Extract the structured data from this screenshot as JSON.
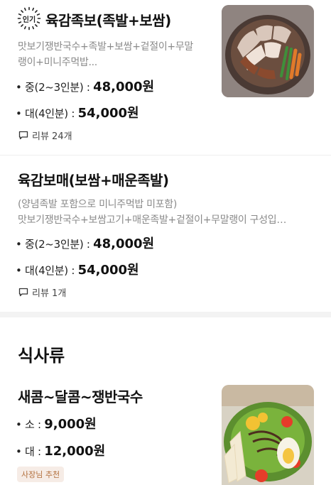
{
  "items": [
    {
      "popular_badge": "인기",
      "name": "육감족보(족발+보쌈)",
      "desc_line1": "맛보기쟁반국수+족발+보쌈+겉절이+무말",
      "desc_line2": "랭이+미니주먹밥...",
      "options": [
        {
          "label": "• 중(2~3인분) : ",
          "price": "48,000원"
        },
        {
          "label": "• 대(4인분) : ",
          "price": "54,000원"
        }
      ],
      "review": "리뷰 24개"
    },
    {
      "name": "육감보매(보쌈+매운족발)",
      "desc_line1": "(양념족발 포함으로 미니주먹밥 미포함)",
      "desc_line2": "맛보기쟁반국수+보쌈고기+매운족발+겉절이+무말랭이 구성입…",
      "options": [
        {
          "label": "• 중(2~3인분) : ",
          "price": "48,000원"
        },
        {
          "label": "• 대(4인분) : ",
          "price": "54,000원"
        }
      ],
      "review": "리뷰 1개"
    }
  ],
  "section": {
    "title": "식사류",
    "item": {
      "name": "새콤~달콤~쟁반국수",
      "options": [
        {
          "label": "• 소 : ",
          "price": "9,000원"
        },
        {
          "label": "• 대 : ",
          "price": "12,000원"
        }
      ],
      "tag": "사장님 추천"
    }
  },
  "colors": {
    "desc": "#8a8a8a",
    "tag_bg": "#f6ece6",
    "tag_text": "#b3703e"
  }
}
